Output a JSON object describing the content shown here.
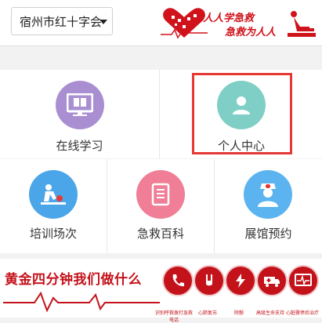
{
  "header": {
    "org_select": {
      "value": "宿州市红十字会"
    },
    "slogan_line1": "人人学急救",
    "slogan_line2": "急救为人人",
    "colors": {
      "brand_red": "#d0121b"
    }
  },
  "grid": {
    "row1": [
      {
        "label": "在线学习",
        "icon": "book-screen-icon",
        "color": "#a98fd1"
      },
      {
        "label": "个人中心",
        "icon": "user-icon",
        "color": "#7fcfc6"
      }
    ],
    "row2": [
      {
        "label": "培训场次",
        "icon": "cpr-person-icon",
        "color": "#4aa6e8"
      },
      {
        "label": "急救百科",
        "icon": "document-icon",
        "color": "#ef7e96"
      },
      {
        "label": "展馆预约",
        "icon": "nurse-icon",
        "color": "#5bb4ef"
      }
    ]
  },
  "bottom_banner": {
    "title": "黄金四分钟我们做什么",
    "captions": [
      "识别呼救拨打急救电话",
      "心肺复苏",
      "除颤",
      "高级生命支持",
      "心脏骤停后治疗"
    ],
    "icons": [
      "phone-icon",
      "hands-icon",
      "defibrillator-icon",
      "ambulance-icon",
      "ecg-monitor-icon"
    ],
    "colors": {
      "accent": "#c4121a"
    }
  }
}
